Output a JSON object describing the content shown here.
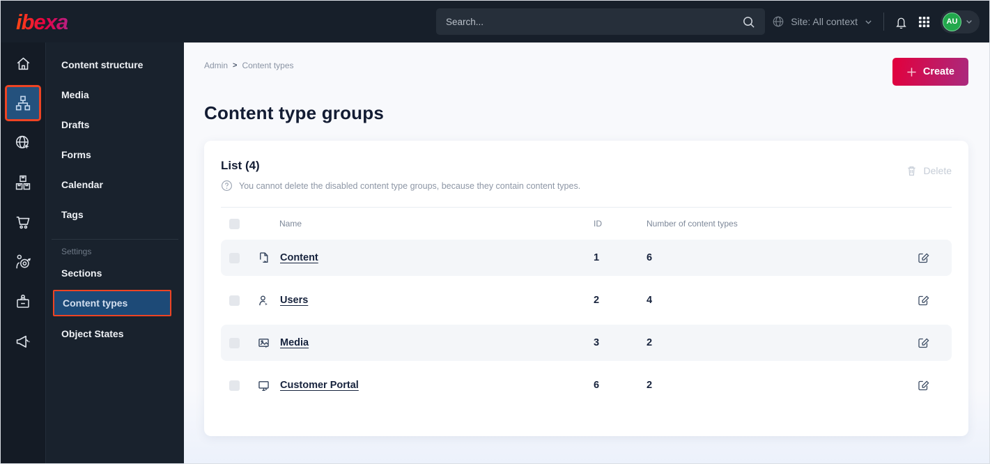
{
  "topbar": {
    "logo": "ibexa",
    "search_placeholder": "Search...",
    "site_label": "Site: All context",
    "avatar_initials": "AU"
  },
  "sidebar": {
    "rail_items": [
      "home",
      "content-structure",
      "site",
      "product-catalog",
      "commerce",
      "personalization",
      "admin-badge",
      "marketing"
    ],
    "rail_active": "content-structure",
    "menu": {
      "items": [
        "Content structure",
        "Media",
        "Drafts",
        "Forms",
        "Calendar",
        "Tags"
      ],
      "settings_label": "Settings",
      "settings_items": [
        "Sections",
        "Content types",
        "Object States"
      ],
      "active": "Content types"
    }
  },
  "main": {
    "breadcrumb": [
      "Admin",
      "Content types"
    ],
    "title": "Content type groups",
    "create_label": "Create",
    "panel": {
      "heading": "List (4)",
      "note": "You cannot delete the disabled content type groups, because they contain content types.",
      "delete_label": "Delete",
      "table": {
        "columns": {
          "name": "Name",
          "id": "ID",
          "count": "Number of content types"
        },
        "rows": [
          {
            "name": "Content",
            "icon": "file-icon",
            "id": "1",
            "count": "6"
          },
          {
            "name": "Users",
            "icon": "user-icon",
            "id": "2",
            "count": "4"
          },
          {
            "name": "Media",
            "icon": "image-icon",
            "id": "3",
            "count": "2"
          },
          {
            "name": "Customer Portal",
            "icon": "monitor-icon",
            "id": "6",
            "count": "2"
          }
        ]
      }
    }
  },
  "colors": {
    "topbar_bg": "#171f2a",
    "accent_orange": "#ee4423",
    "selected_blue": "#1d4a77",
    "create_gradient_start": "#e2003c",
    "create_gradient_end": "#aa2a7e",
    "avatar_green": "#22a84c",
    "text_dark": "#17233d",
    "row_stripe": "#f4f6f9"
  }
}
